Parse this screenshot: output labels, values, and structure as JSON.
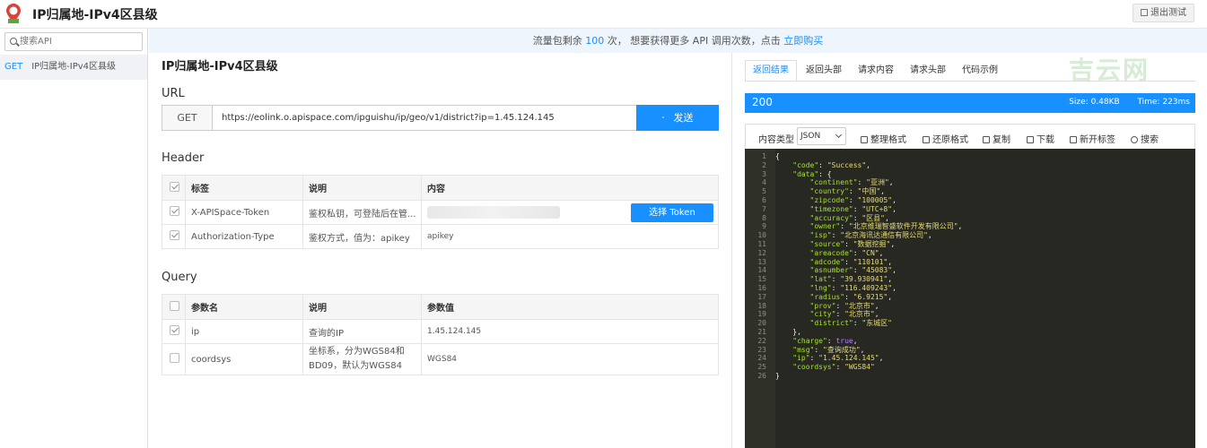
{
  "header": {
    "title": "IP归属地-IPv4区县级",
    "logout_label": "退出测试"
  },
  "sidebar": {
    "search_placeholder": "搜索API",
    "items": [
      {
        "method": "GET",
        "label": "IP归属地-IPv4区县级"
      }
    ]
  },
  "notice": {
    "prefix": "流量包剩余",
    "count": "100",
    "middle": "次， 想要获得更多 API 调用次数，点击",
    "link": "立即购买"
  },
  "main": {
    "title": "IP归属地-IPv4区县级",
    "url_section": "URL",
    "method": "GET",
    "url": "https://eolink.o.apispace.com/ipguishu/ip/geo/v1/district?ip=1.45.124.145",
    "send_label": "发送",
    "header_section": "Header",
    "header_columns": [
      "标签",
      "说明",
      "内容"
    ],
    "header_rows": [
      {
        "name": "X-APISpace-Token",
        "desc": "鉴权私钥，可登陆后在管...",
        "value": "",
        "action": "选择 Token"
      },
      {
        "name": "Authorization-Type",
        "desc": "鉴权方式，值为：apikey",
        "value": "apikey"
      }
    ],
    "query_section": "Query",
    "query_columns": [
      "参数名",
      "说明",
      "参数值"
    ],
    "query_rows": [
      {
        "name": "ip",
        "desc": "查询的IP",
        "value": "1.45.124.145",
        "checked": true
      },
      {
        "name": "coordsys",
        "desc": "坐标系，分为WGS84和BD09，默认为WGS84",
        "value": "WGS84",
        "checked": false
      }
    ]
  },
  "right": {
    "tabs": [
      "返回结果",
      "返回头部",
      "请求内容",
      "请求头部",
      "代码示例"
    ],
    "watermark": "吉云网",
    "status_code": "200",
    "size": "Size:  0.48KB",
    "time": "Time:  223ms",
    "content_type_label": "内容类型",
    "content_type": "JSON",
    "actions": [
      "整理格式",
      "还原格式",
      "复制",
      "下载",
      "新开标签",
      "搜索"
    ]
  },
  "code_lines": [
    "{",
    "    \"code\": \"Success\",",
    "    \"data\": {",
    "        \"continent\": \"亚洲\",",
    "        \"country\": \"中国\",",
    "        \"zipcode\": \"100005\",",
    "        \"timezone\": \"UTC+8\",",
    "        \"accuracy\": \"区县\",",
    "        \"owner\": \"北京维瑞智盛软件开发有限公司\",",
    "        \"isp\": \"北京海讯达通信有限公司\",",
    "        \"source\": \"数据挖掘\",",
    "        \"areacode\": \"CN\",",
    "        \"adcode\": \"110101\",",
    "        \"asnumber\": \"45083\",",
    "        \"lat\": \"39.930941\",",
    "        \"lng\": \"116.409243\",",
    "        \"radius\": \"6.9215\",",
    "        \"prov\": \"北京市\",",
    "        \"city\": \"北京市\",",
    "        \"district\": \"东城区\"",
    "    },",
    "    \"charge\": true,",
    "    \"msg\": \"查询成功\",",
    "    \"ip\": \"1.45.124.145\",",
    "    \"coordsys\": \"WGS84\"",
    "}"
  ]
}
